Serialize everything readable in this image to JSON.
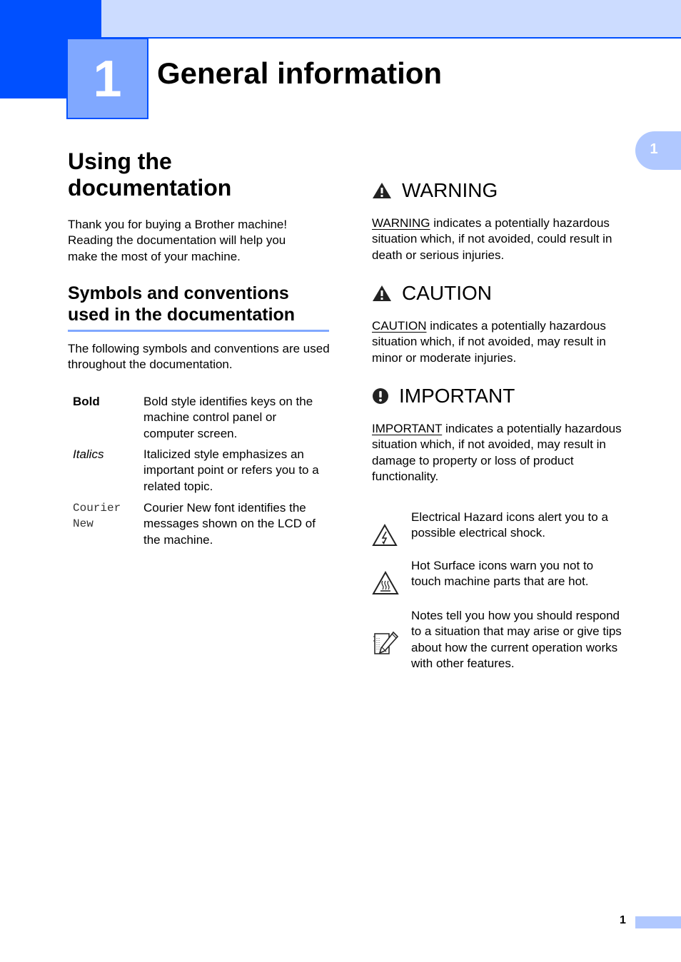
{
  "header": {
    "chapter_number": "1",
    "title": "General information",
    "side_tab_number": "1"
  },
  "colors": {
    "brand_dark": "#0050ff",
    "brand_light": "#ccdcff",
    "brand_mid": "#80a8ff",
    "tab": "#b0c8ff"
  },
  "left": {
    "section_title": "Using the documentation",
    "intro": "Thank you for buying a Brother machine! Reading the documentation will help you make the most of your machine.",
    "subsection_title": "Symbols and conventions used in the documentation",
    "sub_intro": "The following symbols and conventions are used throughout the documentation.",
    "conventions": [
      {
        "term": "Bold",
        "desc": "Bold style identifies keys on the machine control panel or computer screen."
      },
      {
        "term": "Italics",
        "desc": "Italicized style emphasizes an important point or refers you to a related topic."
      },
      {
        "term": "Courier New",
        "desc": "Courier New font identifies the messages shown on the LCD of the machine."
      }
    ]
  },
  "right": {
    "warning": {
      "title": "WARNING",
      "keyword": "WARNING",
      "text": " indicates a potentially hazardous situation which, if not avoided, could result in death or serious injuries.",
      "icon": "warning-triangle-icon"
    },
    "caution": {
      "title": "CAUTION",
      "keyword": "CAUTION",
      "text": " indicates a potentially hazardous situation which, if not avoided, may result in minor or moderate injuries.",
      "icon": "caution-triangle-icon"
    },
    "important": {
      "title": "IMPORTANT",
      "keyword": "IMPORTANT",
      "text": " indicates a potentially hazardous situation which, if not avoided, may result in damage to property or loss of product functionality.",
      "icon": "exclamation-circle-icon"
    },
    "icons": [
      {
        "icon": "electrical-hazard-icon",
        "text": "Electrical Hazard icons alert you to a possible electrical shock."
      },
      {
        "icon": "hot-surface-icon",
        "text": "Hot Surface icons warn you not to touch machine parts that are hot."
      },
      {
        "icon": "note-pencil-icon",
        "text": "Notes tell you how you should respond to a situation that may arise or give tips about how the current operation works with other features."
      }
    ]
  },
  "footer": {
    "page_number": "1"
  }
}
